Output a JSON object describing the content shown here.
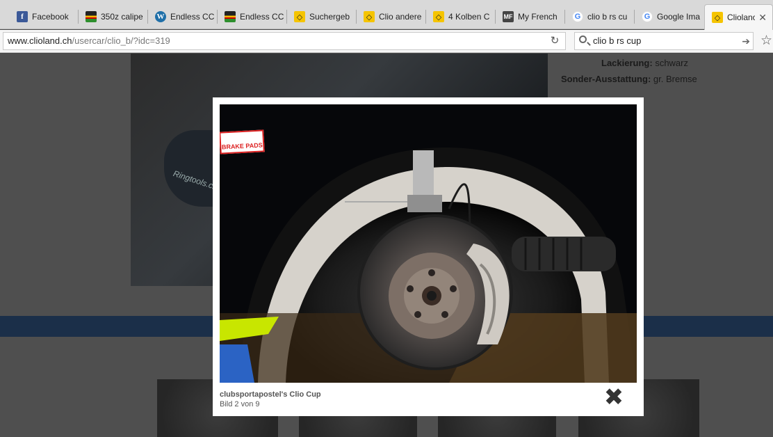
{
  "tabs": [
    {
      "label": "Facebook",
      "icon": "facebook-icon",
      "icon_glyph": "f"
    },
    {
      "label": "350z calipe",
      "icon": "car-parts-icon",
      "icon_glyph": ""
    },
    {
      "label": "Endless CC",
      "icon": "wordpress-icon",
      "icon_glyph": "W"
    },
    {
      "label": "Endless CC",
      "icon": "car-parts-icon",
      "icon_glyph": ""
    },
    {
      "label": "Suchergeb",
      "icon": "renault-icon",
      "icon_glyph": "◇"
    },
    {
      "label": "Clio andere",
      "icon": "renault-icon",
      "icon_glyph": "◇"
    },
    {
      "label": "4 Kolben C",
      "icon": "renault-icon",
      "icon_glyph": "◇"
    },
    {
      "label": "My French",
      "icon": "site-icon",
      "icon_glyph": "MF"
    },
    {
      "label": "clio b rs cu",
      "icon": "google-icon",
      "icon_glyph": "G"
    },
    {
      "label": "Google Ima",
      "icon": "google-icon",
      "icon_glyph": "G"
    },
    {
      "label": "Cliolanc",
      "icon": "renault-icon",
      "icon_glyph": "◇",
      "active": true
    }
  ],
  "address": {
    "domain": "www.clioland.ch",
    "path": "/usercar/clio_b/?idc=319"
  },
  "search": {
    "value": "clio b rs cup"
  },
  "toolbar_icons": {
    "reload": "↻",
    "go": "➔",
    "bookmark": "☆",
    "tab_close": "✕"
  },
  "specs": {
    "paint_label": "Lackierung:",
    "paint_value": "schwarz",
    "extras_label": "Sonder-Ausstattung:",
    "extras_value": "gr. Bremse"
  },
  "background_photo": {
    "watermark": "Ringtools.ch"
  },
  "lightbox": {
    "badge": "BRAKE PADS",
    "title": "clubsportapostel's Clio Cup",
    "counter": "Bild 2 von 9",
    "close_glyph": "✖"
  }
}
